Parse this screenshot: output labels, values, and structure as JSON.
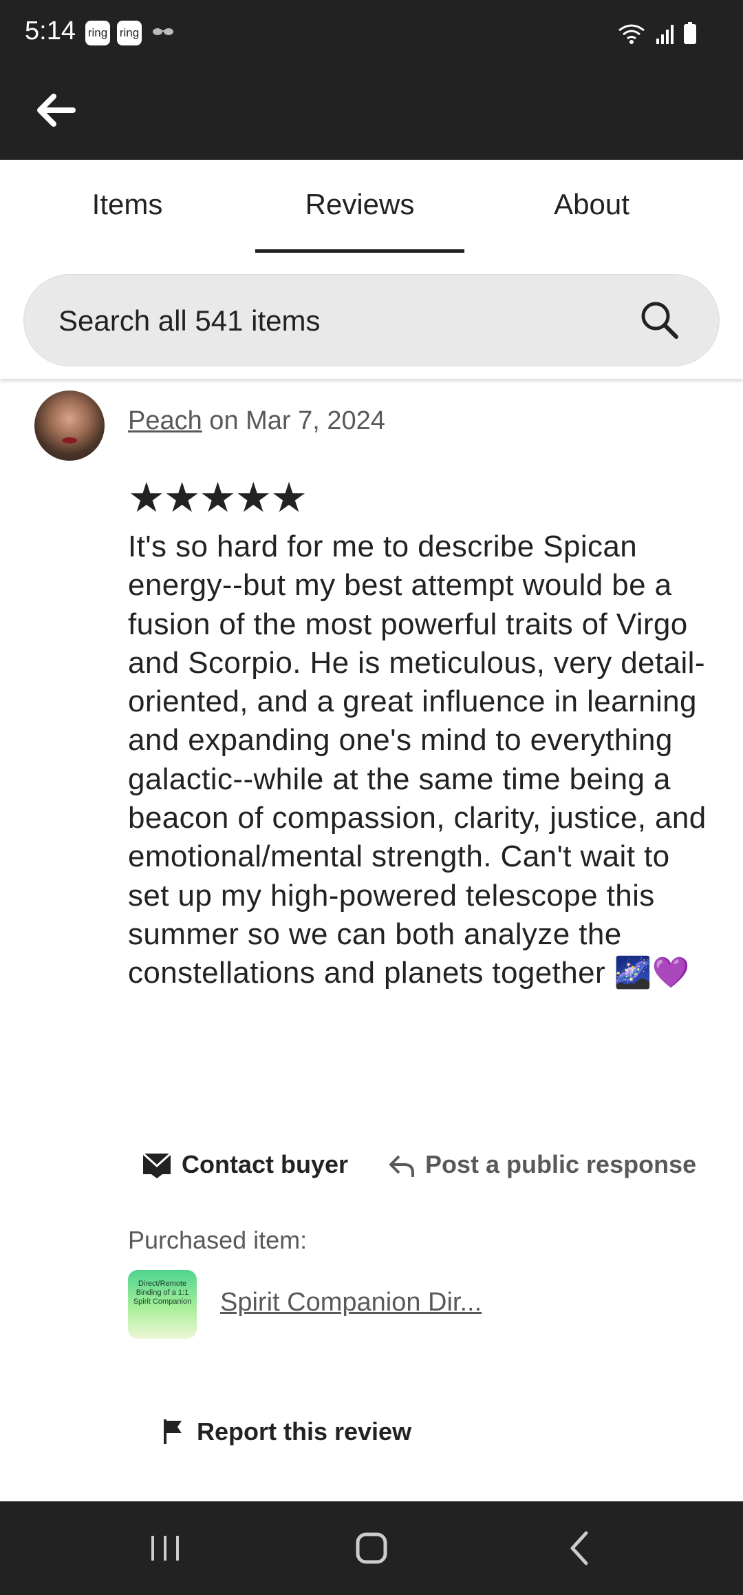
{
  "status_bar": {
    "time": "5:14",
    "notification_badges": [
      "ring",
      "ring"
    ],
    "icons": [
      "glasses-icon",
      "wifi-icon",
      "signal-icon",
      "battery-icon"
    ]
  },
  "app_bar": {
    "back_icon": "arrow-left-icon"
  },
  "tabs": [
    {
      "label": "Items",
      "selected": false
    },
    {
      "label": "Reviews",
      "selected": true
    },
    {
      "label": "About",
      "selected": false
    }
  ],
  "search": {
    "placeholder": "Search all 541 items",
    "icon": "search-icon"
  },
  "review": {
    "reviewer": "Peach",
    "date_text": " on Mar 7, 2024",
    "rating": 5,
    "stars": "★★★★★",
    "body": "It's so hard for me to describe Spican energy--but my best attempt would be a fusion of the most powerful traits of Virgo and Scorpio. He is meticulous, very detail-oriented, and a great influence in learning and expanding one's mind to everything galactic--while at the same time being a beacon of compassion, clarity, justice, and emotional/mental strength. Can't wait to set up my high-powered telescope this summer so we can both analyze the constellations and planets together 🌌💜",
    "contact_label": "Contact buyer",
    "respond_label": "Post a public response",
    "purchased_label": "Purchased item:",
    "item_thumb_text": "Direct/Remote Binding of a 1:1 Spirit Companion",
    "item_title": "Spirit Companion Dir...",
    "report_label": "Report this review"
  },
  "nav_bar": {
    "icons": [
      "recent-apps-icon",
      "home-icon",
      "back-nav-icon"
    ]
  }
}
